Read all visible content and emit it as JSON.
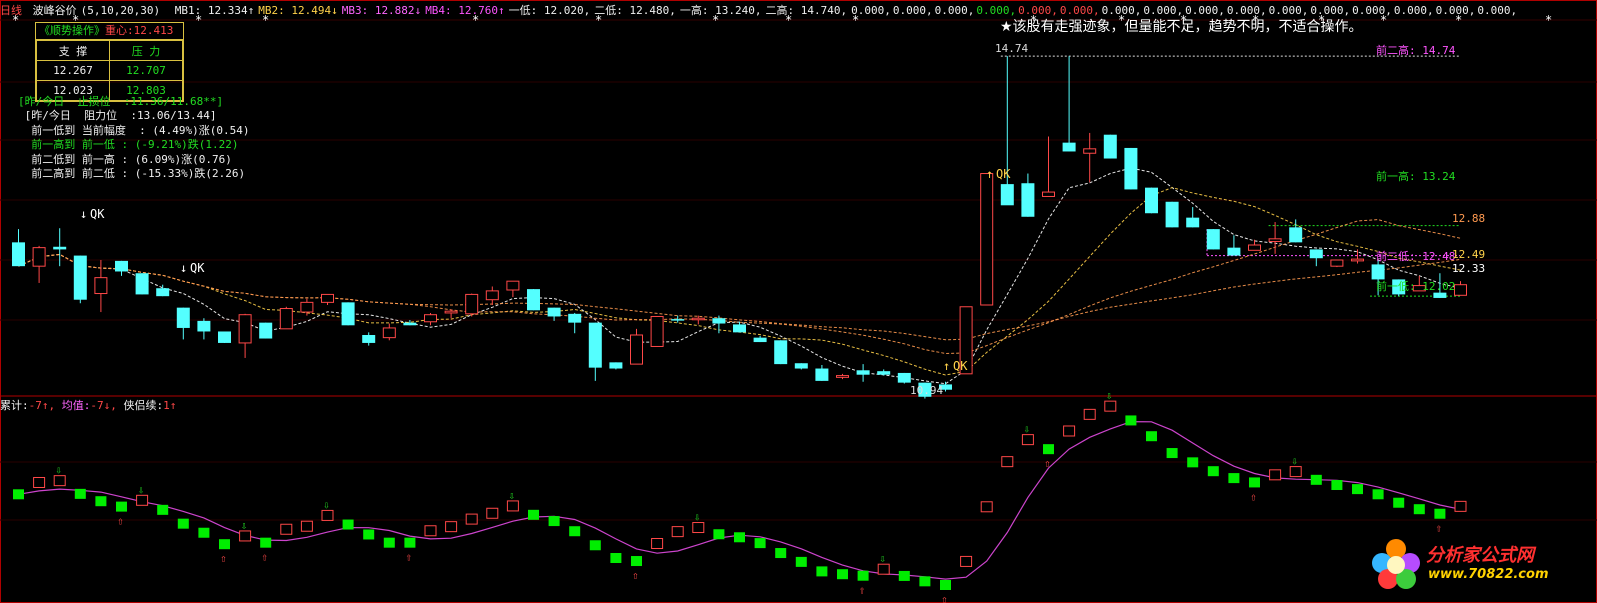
{
  "header": {
    "period": "日线",
    "indicator": "波峰谷价",
    "params": "(5,10,20,30)",
    "items": [
      {
        "label": "MB1:",
        "value": "12.334",
        "arrow": "↑",
        "color": "#f0f0f0"
      },
      {
        "label": "MB2:",
        "value": "12.494",
        "arrow": "↓",
        "color": "#ffd24a"
      },
      {
        "label": "MB3:",
        "value": "12.882",
        "arrow": "↓",
        "color": "#ff66ff"
      },
      {
        "label": "MB4:",
        "value": "12.760",
        "arrow": "↑",
        "color": "#ff55ff"
      },
      {
        "label": "一低:",
        "value": "12.020,",
        "arrow": "",
        "color": "#f0f0f0"
      },
      {
        "label": "二低:",
        "value": "12.480,",
        "arrow": "",
        "color": "#f0f0f0"
      },
      {
        "label": "一高:",
        "value": "13.240,",
        "arrow": "",
        "color": "#f0f0f0"
      },
      {
        "label": "二高:",
        "value": "14.740,",
        "arrow": "",
        "color": "#f0f0f0"
      }
    ],
    "zeros": [
      {
        "text": "0.000,",
        "color": "#f0f0f0"
      },
      {
        "text": "0.000,",
        "color": "#f0f0f0"
      },
      {
        "text": "0.000,",
        "color": "#f0f0f0"
      },
      {
        "text": "0.000,",
        "color": "#22dd22"
      },
      {
        "text": "0.000,",
        "color": "#ff4848"
      },
      {
        "text": "0.000,",
        "color": "#ff4848"
      },
      {
        "text": "0.000,",
        "color": "#f0f0f0"
      },
      {
        "text": "0.000,",
        "color": "#f0f0f0"
      },
      {
        "text": "0.000,",
        "color": "#f0f0f0"
      },
      {
        "text": "0.000,",
        "color": "#f0f0f0"
      },
      {
        "text": "0.000,",
        "color": "#f0f0f0"
      },
      {
        "text": "0.000,",
        "color": "#f0f0f0"
      },
      {
        "text": "0.000,",
        "color": "#f0f0f0"
      },
      {
        "text": "0.000,",
        "color": "#f0f0f0"
      },
      {
        "text": "0.000,",
        "color": "#f0f0f0"
      },
      {
        "text": "0.000,",
        "color": "#f0f0f0"
      }
    ]
  },
  "notice": "★该股有走强迹象，但量能不足，趋势不明，不适合操作。",
  "panel": {
    "title": "《顺势操作》",
    "center_label": "重心:",
    "center_value": "12.413",
    "col_support": "支 撑",
    "col_pressure": "压 力",
    "rows": [
      [
        "12.267",
        "12.707"
      ],
      [
        "12.023",
        "12.803"
      ]
    ]
  },
  "info_lines": [
    {
      "text": "[昨/今日  止损位  :11.36/11.68**]",
      "color": "#22dd22"
    },
    {
      "text": " [昨/今日  阻力位  :13.06/13.44]",
      "color": "#f0f0f0"
    },
    {
      "text": "  前一低到 当前幅度  : (4.49%)涨(0.54)",
      "color": "#f0f0f0"
    },
    {
      "text": "  前一高到 前一低 : (-9.21%)跌(1.22)",
      "color": "#22dd22"
    },
    {
      "text": "  前二低到 前一高 : (6.09%)涨(0.76)",
      "color": "#f0f0f0"
    },
    {
      "text": "  前二高到 前二低 : (-15.33%)跌(2.26)",
      "color": "#f0f0f0"
    }
  ],
  "indicator_line": {
    "sum_label": "累计:",
    "sum_value": "-7↑,",
    "avg_label": "均值:",
    "avg_value": "-7↓,",
    "cont_label": "侠侣续:",
    "cont_value": "1↑"
  },
  "annotations": {
    "prev_high2": "前二高: 14.74",
    "prev_high1": "前一高: 13.24",
    "prev_low2": "前二低: 12.48",
    "prev_low1": "前一低: 12.02",
    "peak_label": "14.74",
    "trough_label": "10.94",
    "qk": "QK"
  },
  "right_labels": [
    "12.88",
    "12.49",
    "12.33"
  ],
  "colors": {
    "up": "#ff4848",
    "down": "#54ffff",
    "ma1": "#ffffff",
    "ma2": "#ffd24a",
    "ma3": "#ff9a50",
    "ind_line": "#cc44cc",
    "frame": "#b00000"
  },
  "chart_data": {
    "type": "candlestick",
    "ylim": [
      10.9,
      15.15
    ],
    "candles": [
      [
        12.63,
        12.36,
        12.78,
        12.36
      ],
      [
        12.36,
        12.57,
        12.59,
        12.17
      ],
      [
        12.58,
        12.55,
        12.79,
        12.36
      ],
      [
        12.48,
        11.98,
        12.48,
        11.94
      ],
      [
        12.05,
        12.23,
        12.43,
        11.84
      ],
      [
        12.42,
        12.3,
        12.42,
        12.25
      ],
      [
        12.28,
        12.04,
        12.28,
        12.04
      ],
      [
        12.11,
        12.02,
        12.15,
        12.02
      ],
      [
        11.89,
        11.66,
        11.89,
        11.53
      ],
      [
        11.74,
        11.62,
        11.77,
        11.53
      ],
      [
        11.62,
        11.49,
        11.62,
        11.49
      ],
      [
        11.49,
        11.81,
        11.82,
        11.32
      ],
      [
        11.72,
        11.54,
        11.72,
        11.54
      ],
      [
        11.65,
        11.88,
        11.9,
        11.65
      ],
      [
        11.84,
        11.95,
        11.99,
        11.8
      ],
      [
        11.95,
        12.04,
        12.04,
        11.92
      ],
      [
        11.95,
        11.69,
        11.95,
        11.69
      ],
      [
        11.58,
        11.49,
        11.61,
        11.46
      ],
      [
        11.55,
        11.66,
        11.71,
        11.52
      ],
      [
        11.72,
        11.69,
        11.75,
        11.69
      ],
      [
        11.73,
        11.81,
        11.83,
        11.69
      ],
      [
        11.83,
        11.85,
        11.87,
        11.77
      ],
      [
        11.82,
        12.04,
        12.05,
        11.79
      ],
      [
        11.98,
        12.08,
        12.13,
        11.92
      ],
      [
        12.09,
        12.19,
        12.19,
        12.01
      ],
      [
        12.1,
        11.86,
        12.1,
        11.86
      ],
      [
        11.89,
        11.79,
        11.89,
        11.74
      ],
      [
        11.82,
        11.72,
        11.83,
        11.6
      ],
      [
        11.72,
        11.21,
        11.72,
        11.06
      ],
      [
        11.27,
        11.2,
        11.27,
        11.19
      ],
      [
        11.25,
        11.58,
        11.65,
        11.25
      ],
      [
        11.45,
        11.79,
        11.79,
        11.45
      ],
      [
        11.76,
        11.75,
        11.8,
        11.72
      ],
      [
        11.76,
        11.77,
        11.8,
        11.7
      ],
      [
        11.77,
        11.71,
        11.8,
        11.6
      ],
      [
        11.7,
        11.61,
        11.73,
        11.61
      ],
      [
        11.55,
        11.5,
        11.57,
        11.5
      ],
      [
        11.52,
        11.25,
        11.52,
        11.25
      ],
      [
        11.26,
        11.2,
        11.26,
        11.19
      ],
      [
        11.2,
        11.06,
        11.24,
        11.06
      ],
      [
        11.1,
        11.12,
        11.14,
        11.08
      ],
      [
        11.18,
        11.13,
        11.25,
        11.05
      ],
      [
        11.17,
        11.13,
        11.19,
        11.12
      ],
      [
        11.15,
        11.04,
        11.15,
        11.03
      ],
      [
        11.04,
        10.88,
        11.04,
        10.86
      ],
      [
        11.02,
        10.96,
        11.05,
        10.94
      ],
      [
        11.14,
        11.9,
        11.9,
        11.14
      ],
      [
        11.92,
        13.41,
        13.41,
        11.92
      ],
      [
        13.29,
        13.05,
        14.74,
        13.06
      ],
      [
        13.3,
        12.92,
        13.41,
        12.92
      ],
      [
        13.15,
        13.2,
        13.83,
        13.15
      ],
      [
        13.76,
        13.66,
        14.74,
        13.66
      ],
      [
        13.64,
        13.69,
        13.87,
        13.31
      ],
      [
        13.85,
        13.58,
        13.85,
        13.58
      ],
      [
        13.7,
        13.23,
        13.7,
        13.23
      ],
      [
        13.25,
        12.96,
        13.25,
        12.96
      ],
      [
        13.09,
        12.8,
        13.09,
        12.8
      ],
      [
        12.91,
        12.8,
        13.03,
        12.8
      ],
      [
        12.78,
        12.55,
        12.78,
        12.55
      ],
      [
        12.57,
        12.48,
        12.71,
        12.48
      ],
      [
        12.54,
        12.6,
        12.66,
        12.55
      ],
      [
        12.64,
        12.67,
        12.86,
        12.5
      ],
      [
        12.8,
        12.63,
        12.89,
        12.63
      ],
      [
        12.55,
        12.45,
        12.55,
        12.36
      ],
      [
        12.36,
        12.43,
        12.43,
        12.35
      ],
      [
        12.42,
        12.44,
        12.55,
        12.39
      ],
      [
        12.38,
        12.21,
        12.43,
        12.03
      ],
      [
        12.21,
        12.04,
        12.21,
        12.02
      ],
      [
        12.08,
        12.14,
        12.25,
        12.08
      ],
      [
        12.06,
        12.0,
        12.28,
        12.0
      ],
      [
        12.03,
        12.15,
        12.19,
        12.05
      ]
    ]
  }
}
